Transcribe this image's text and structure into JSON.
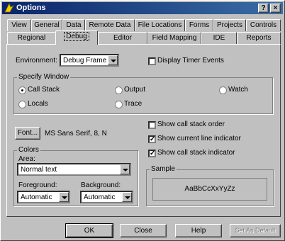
{
  "window": {
    "title": "Options"
  },
  "titlebar": {
    "help_glyph": "?",
    "close_glyph": "×"
  },
  "tabs_back": [
    "View",
    "General",
    "Data",
    "Remote Data",
    "File Locations",
    "Forms",
    "Projects",
    "Controls"
  ],
  "tabs_front": [
    "Regional",
    "Debug",
    "Editor",
    "Field Mapping",
    "IDE",
    "Reports"
  ],
  "active_tab": "Debug",
  "environment": {
    "label": "Environment:",
    "value": "Debug Frame"
  },
  "display_timer_events": {
    "label": "Display Timer Events",
    "checked": false
  },
  "specify_window": {
    "label": "Specify Window",
    "options": [
      {
        "label": "Call Stack",
        "selected": true
      },
      {
        "label": "Output",
        "selected": false
      },
      {
        "label": "Watch",
        "selected": false
      },
      {
        "label": "Locals",
        "selected": false
      },
      {
        "label": "Trace",
        "selected": false
      }
    ]
  },
  "font": {
    "button_label": "Font...",
    "value": "MS Sans Serif, 8, N"
  },
  "checkboxes": [
    {
      "label": "Show call stack order",
      "checked": false
    },
    {
      "label": "Show current line indicator",
      "checked": true
    },
    {
      "label": "Show call stack indicator",
      "checked": true
    }
  ],
  "colors": {
    "label": "Colors",
    "area_label": "Area:",
    "area_value": "Normal text",
    "foreground_label": "Foreground:",
    "foreground_value": "Automatic",
    "background_label": "Background:",
    "background_value": "Automatic"
  },
  "sample": {
    "label": "Sample",
    "text": "AaBbCcXxYyZz"
  },
  "buttons": {
    "ok": "OK",
    "close": "Close",
    "help": "Help",
    "set_as_default": "Set As Default"
  }
}
